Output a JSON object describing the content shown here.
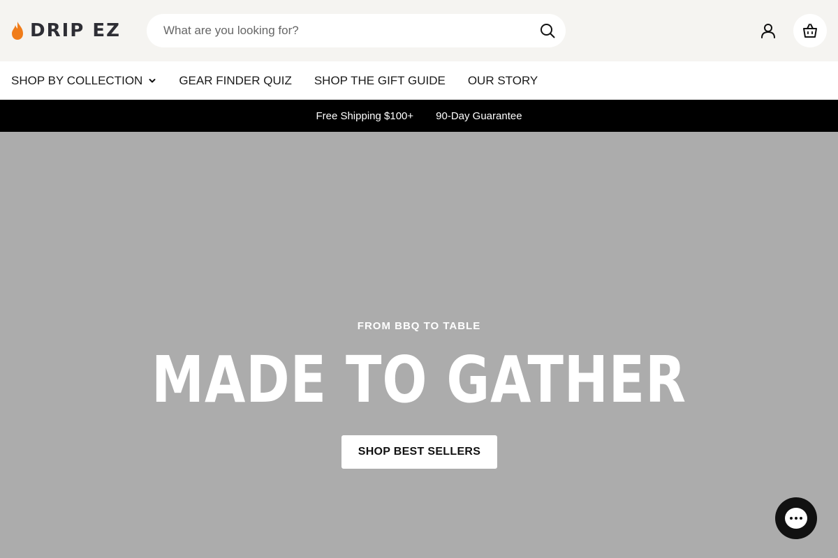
{
  "header": {
    "logo_text": "DRIP EZ",
    "search_placeholder": "What are you looking for?",
    "icons": {
      "search": "search-icon",
      "account": "user-icon",
      "cart": "bag-icon",
      "logo": "flame-icon"
    },
    "accent_color": "#f07c1a"
  },
  "nav": {
    "items": [
      {
        "label": "SHOP BY COLLECTION",
        "has_dropdown": true
      },
      {
        "label": "GEAR FINDER QUIZ"
      },
      {
        "label": "SHOP THE GIFT GUIDE"
      },
      {
        "label": "OUR STORY"
      }
    ]
  },
  "promo": {
    "items": [
      "Free Shipping $100+",
      "90-Day Guarantee"
    ]
  },
  "hero": {
    "eyebrow": "FROM BBQ TO TABLE",
    "title": "MADE TO GATHER",
    "cta_label": "SHOP BEST SELLERS",
    "background_color": "#acacac"
  },
  "chat": {
    "icon": "chat-bubble-icon"
  }
}
